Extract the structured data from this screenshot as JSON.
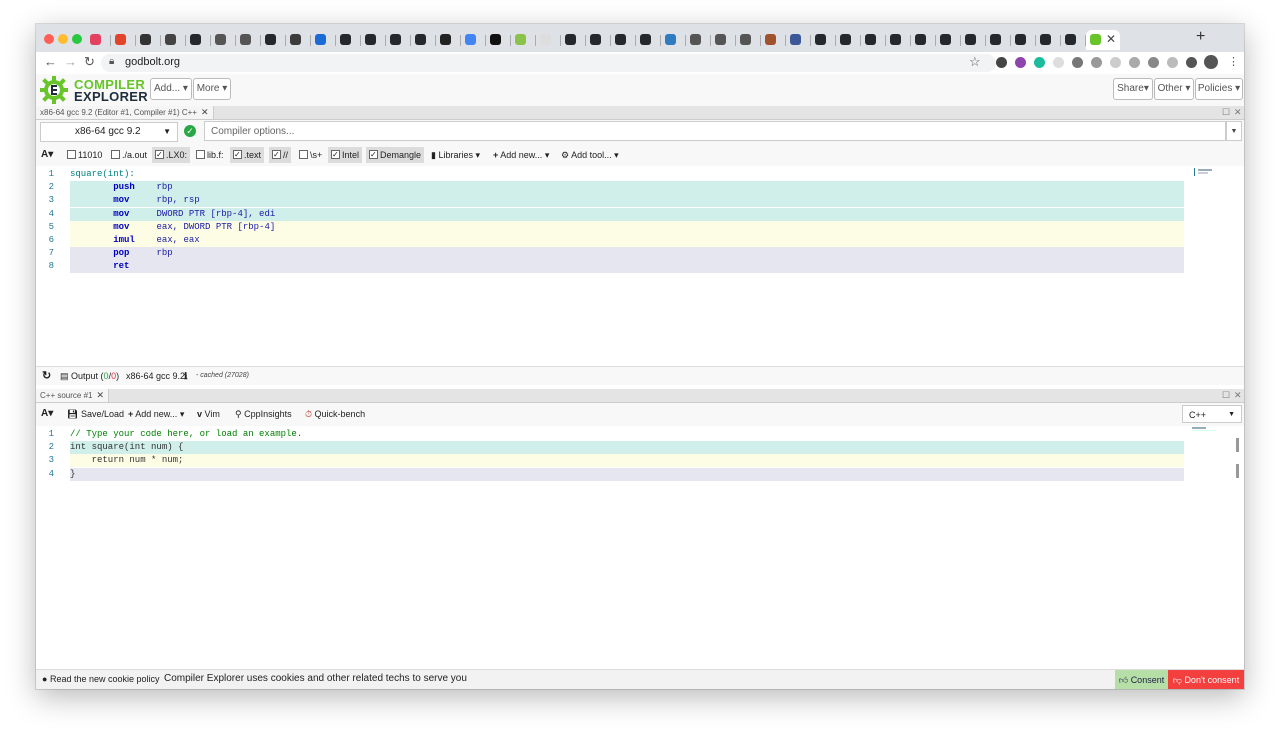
{
  "browser": {
    "url": "godbolt.org",
    "tab_favicon_colors": [
      "#e4405f",
      "#e24329",
      "#333333",
      "#444444",
      "#24292e",
      "#555555",
      "#555555",
      "#24292e",
      "#3c3c3c",
      "#1a6bd6",
      "#24292e",
      "#24292e",
      "#24292e",
      "#24292e",
      "#222222",
      "#4285f4",
      "#111111",
      "#8bc34a",
      "#dddddd",
      "#24292e",
      "#24292e",
      "#24292e",
      "#24292e",
      "#2f7bbf",
      "#555555",
      "#555555",
      "#555555",
      "#a0522d",
      "#3b5998",
      "#24292e",
      "#24292e",
      "#24292e",
      "#24292e",
      "#24292e",
      "#24292e",
      "#24292e",
      "#24292e",
      "#24292e",
      "#24292e",
      "#24292e"
    ],
    "extension_colors": [
      "#444444",
      "#8e44ad",
      "#1abc9c",
      "#dddddd",
      "#777777",
      "#999999",
      "#cccccc",
      "#aaaaaa",
      "#888888",
      "#bbbbbb",
      "#555555"
    ]
  },
  "header": {
    "logo_line1": "COMPILER",
    "logo_line2": "EXPLORER",
    "add_menu": "Add...",
    "more_menu": "More",
    "share_menu": "Share",
    "other_menu": "Other",
    "policies_menu": "Policies"
  },
  "compiler_pane": {
    "tab_title": "x86-64 gcc 9.2 (Editor #1, Compiler #1) C++",
    "compiler_name": "x86-64 gcc 9.2",
    "options_placeholder": "Compiler options...",
    "toolbar": {
      "font": "A",
      "binary": "11010",
      "execute": "./a.out",
      "labels": ".LX0:",
      "libfuncs": "lib.f:",
      "directives": ".text",
      "comments": "//",
      "whitespace": "\\s+",
      "intel": "Intel",
      "demangle": "Demangle",
      "libraries": "Libraries",
      "add_new": "Add new...",
      "add_tool": "Add tool..."
    },
    "asm_lines": [
      {
        "num": "1",
        "label": "square(int):",
        "op": "",
        "args": ""
      },
      {
        "num": "2",
        "label": "",
        "op": "push",
        "args": "rbp"
      },
      {
        "num": "3",
        "label": "",
        "op": "mov",
        "args": "rbp, rsp"
      },
      {
        "num": "4",
        "label": "",
        "op": "mov",
        "args": "DWORD PTR [rbp-4], edi"
      },
      {
        "num": "5",
        "label": "",
        "op": "mov",
        "args": "eax, DWORD PTR [rbp-4]"
      },
      {
        "num": "6",
        "label": "",
        "op": "imul",
        "args": "eax, eax"
      },
      {
        "num": "7",
        "label": "",
        "op": "pop",
        "args": "rbp"
      },
      {
        "num": "8",
        "label": "",
        "op": "ret",
        "args": ""
      }
    ],
    "status": {
      "output_label": "Output (",
      "output_ok": "0",
      "output_sep": "/",
      "output_err": "0",
      "output_close": ")",
      "compiler": "x86-64 gcc 9.2",
      "cached": "- cached (27028)"
    },
    "highlight_colors": {
      "teal": "#d0eeea",
      "yellow": "#fdfde6",
      "lavender": "#e6e6f0"
    }
  },
  "source_pane": {
    "tab_title": "C++ source #1",
    "toolbar": {
      "font": "A",
      "save_load": "Save/Load",
      "add_new": "Add new...",
      "vim": "Vim",
      "cppinsights": "CppInsights",
      "quickbench": "Quick-bench"
    },
    "language": "C++",
    "source_lines": [
      {
        "num": "1",
        "text": "// Type your code here, or load an example."
      },
      {
        "num": "2",
        "text": "int square(int num) {"
      },
      {
        "num": "3",
        "text": "    return num * num;"
      },
      {
        "num": "4",
        "text": "}"
      }
    ]
  },
  "cookie_bar": {
    "policy_link": "Read the new cookie policy",
    "message": "Compiler Explorer uses cookies and other related techs to serve you",
    "consent": "Consent",
    "dont_consent": "Don't consent"
  }
}
